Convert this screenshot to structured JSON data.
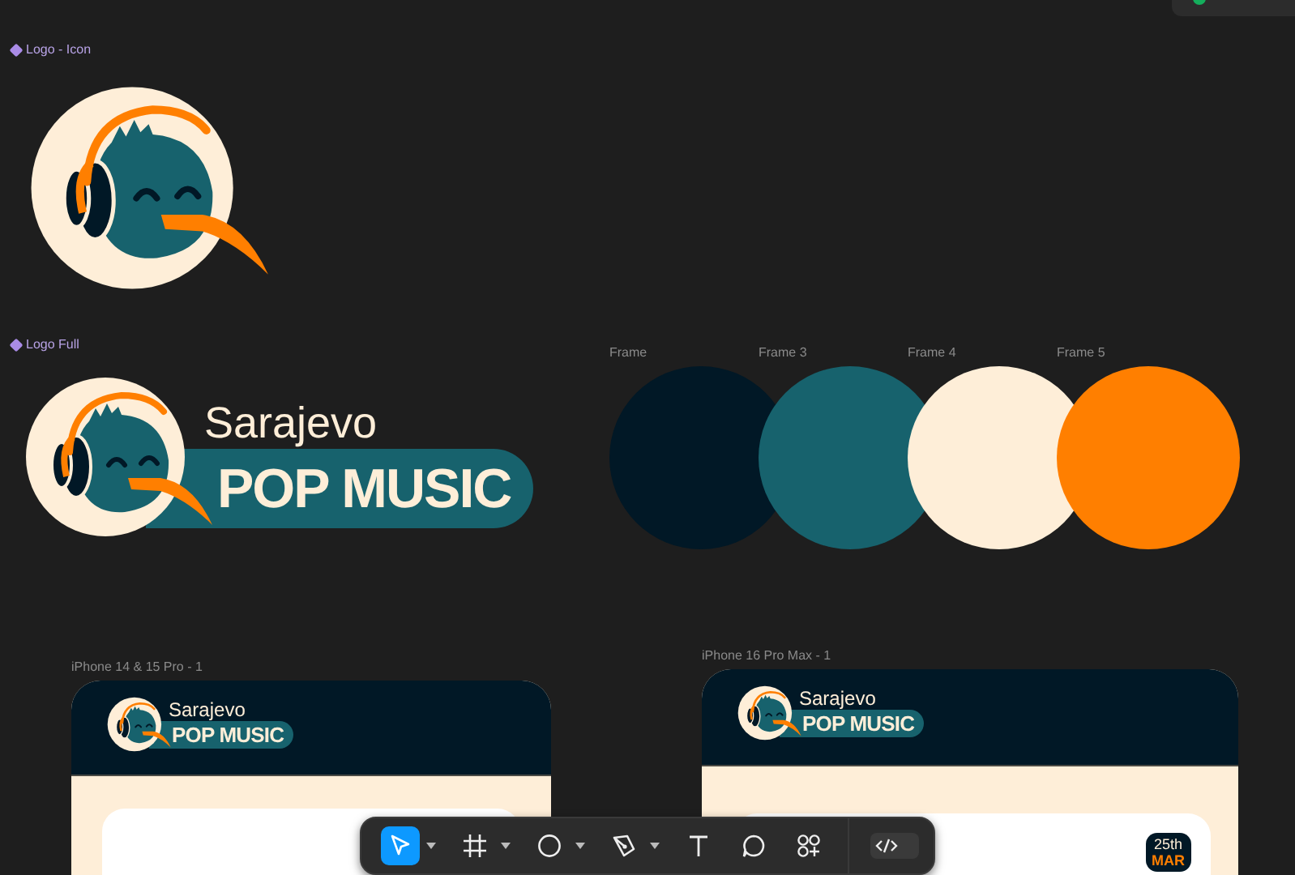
{
  "logo_icon": {
    "label": "Logo - Icon"
  },
  "logo_full": {
    "label": "Logo Full",
    "line1": "Sarajevo",
    "line2": "POP MUSIC"
  },
  "swatches": [
    {
      "label": "Frame",
      "color": "#011826"
    },
    {
      "label": "Frame 3",
      "color": "#17626d"
    },
    {
      "label": "Frame 4",
      "color": "#feeed8"
    },
    {
      "label": "Frame 5",
      "color": "#ff7f00"
    }
  ],
  "phones": [
    {
      "label": "iPhone 14 & 15 Pro - 1",
      "line1": "Sarajevo",
      "line2": "POP MUSIC"
    },
    {
      "label": "iPhone 16 Pro Max - 1",
      "line1": "Sarajevo",
      "line2": "POP MUSIC",
      "date_day": "25th",
      "date_month": "MAR"
    }
  ],
  "toolbar": [
    {
      "kind": "move",
      "selected": true,
      "dropdown": true
    },
    {
      "kind": "frame",
      "selected": false,
      "dropdown": true
    },
    {
      "kind": "shape",
      "selected": false,
      "dropdown": true
    },
    {
      "kind": "pen",
      "selected": false,
      "dropdown": true
    },
    {
      "kind": "text",
      "selected": false,
      "dropdown": false
    },
    {
      "kind": "comment",
      "selected": false,
      "dropdown": false
    },
    {
      "kind": "assets",
      "selected": false,
      "dropdown": false
    },
    {
      "kind": "dev",
      "selected": false,
      "dropdown": false
    }
  ]
}
